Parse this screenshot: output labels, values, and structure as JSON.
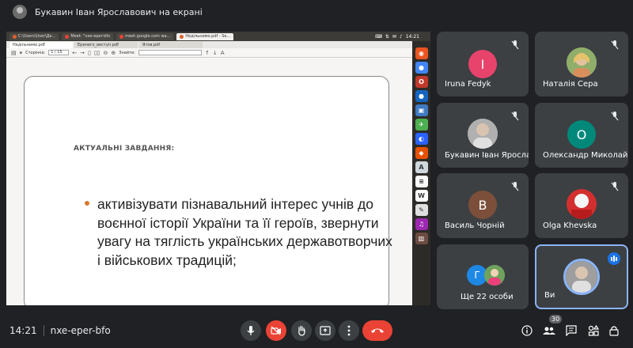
{
  "presenter_bar": {
    "title": "Букавин Іван Ярославович на екрані"
  },
  "shared_screen": {
    "browser_tabs": [
      {
        "label": "C:\\Users\\User\\Де..."
      },
      {
        "label": "Meet: \"nxe-eper-bfo"
      },
      {
        "label": "meet.google.com wa..."
      },
      {
        "label": "Недільнимо.pdf - Se..."
      }
    ],
    "tray_clock": "14:21",
    "pdf_tabs": [
      {
        "label": "Недільнимо.pdf"
      },
      {
        "label": "Еринего_виступ.pdf"
      },
      {
        "label": "Ятов.pdf"
      }
    ],
    "toolbar": {
      "page_label": "Сторінка:",
      "page_value": "1 / 15",
      "find_label": "Знайти:"
    },
    "slide": {
      "heading": "АКТУАЛЬНІ ЗАВДАННЯ:",
      "bullet": "активізувати пізнавальний інтерес учнів до воєнної історії України та її героїв, звернути увагу на тяглість українських державотворчих і військових традицій;"
    }
  },
  "participants": [
    {
      "name": "Iruna Fedyk",
      "initial": "I",
      "color": "#e8436b"
    },
    {
      "name": "Наталія Сера",
      "initial": "",
      "color": ""
    },
    {
      "name": "Букавин Іван Ярославо...",
      "initial": "",
      "color": ""
    },
    {
      "name": "Олександр Миколайов...",
      "initial": "О",
      "color": "#00897b"
    },
    {
      "name": "Василь Чорній",
      "initial": "В",
      "color": "#7b4f3a"
    },
    {
      "name": "Olga Khevska",
      "initial": "",
      "color": ""
    },
    {
      "name": "Ще 22 особи",
      "initial": "Г",
      "color": "#1e88e5"
    },
    {
      "name": "Ви",
      "initial": "",
      "color": ""
    }
  ],
  "bottom_bar": {
    "time": "14:21",
    "meeting_code": "nxe-eper-bfo",
    "people_count": "30"
  },
  "colors": {
    "background": "#202124",
    "tile": "#3c4043",
    "danger": "#ea4335",
    "accent": "#8ab4f8"
  }
}
